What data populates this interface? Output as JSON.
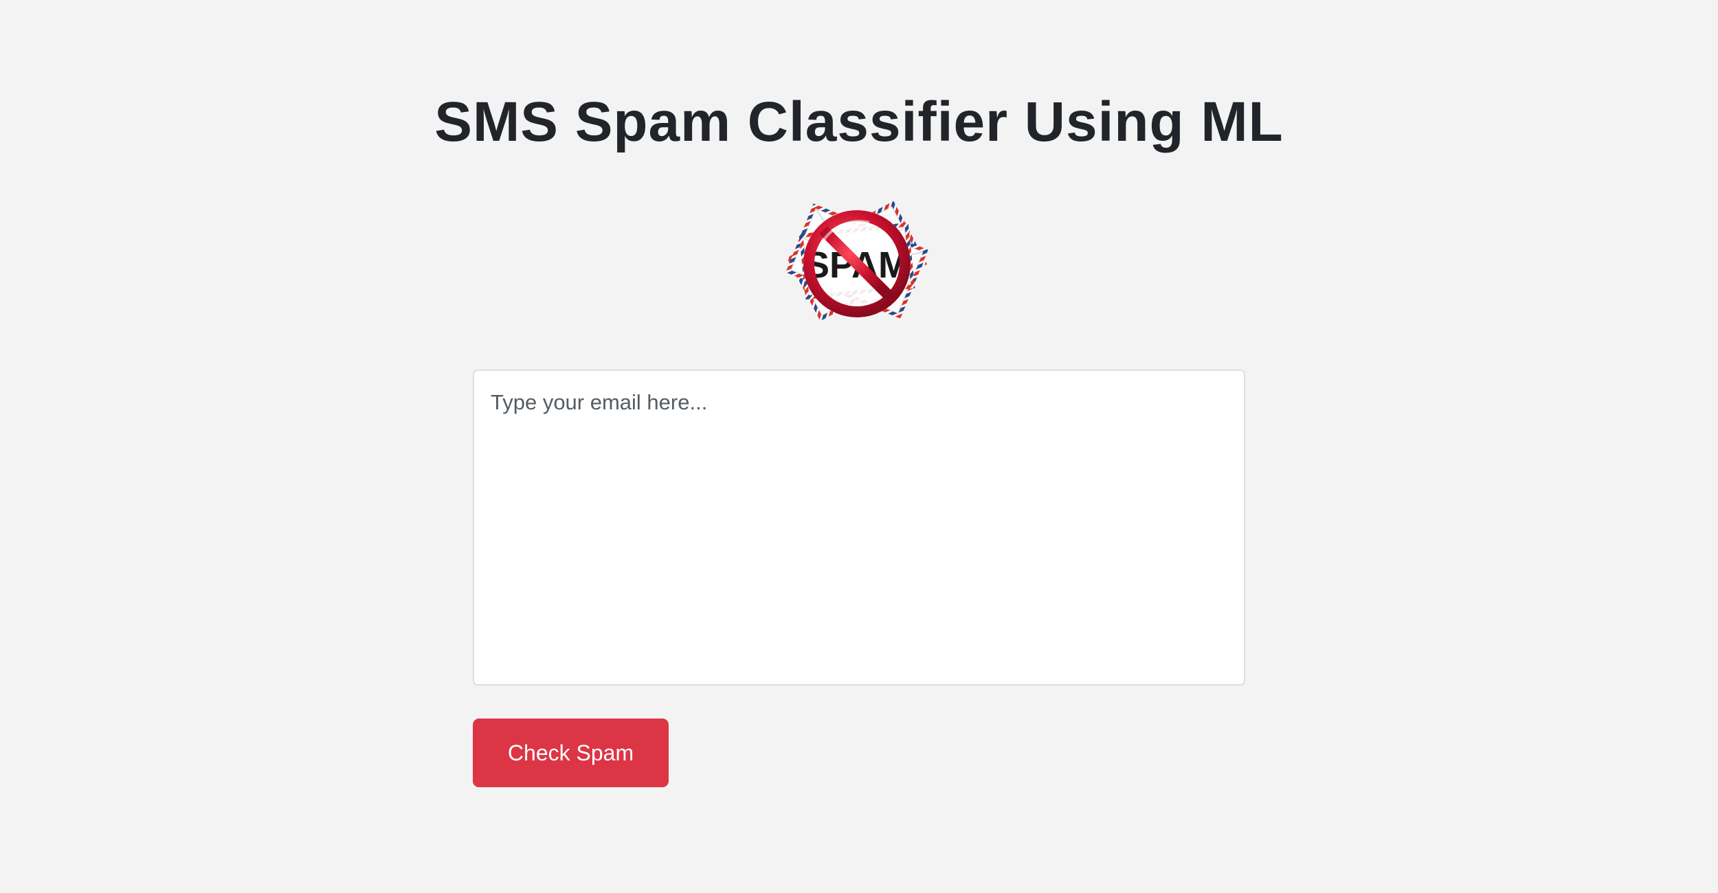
{
  "header": {
    "title": "SMS Spam Classifier Using ML"
  },
  "logo": {
    "icon": "no-spam-icon",
    "label": "SPAM",
    "colors": {
      "ring": "#c8102e",
      "envelope": "#ffffff",
      "airmail_red": "#d9342b",
      "airmail_blue": "#2b4a8c"
    }
  },
  "form": {
    "input": {
      "placeholder": "Type your email here...",
      "value": ""
    },
    "submit_label": "Check Spam"
  },
  "colors": {
    "background": "#f3f3f3",
    "button": "#dc3545",
    "title": "#212529"
  }
}
